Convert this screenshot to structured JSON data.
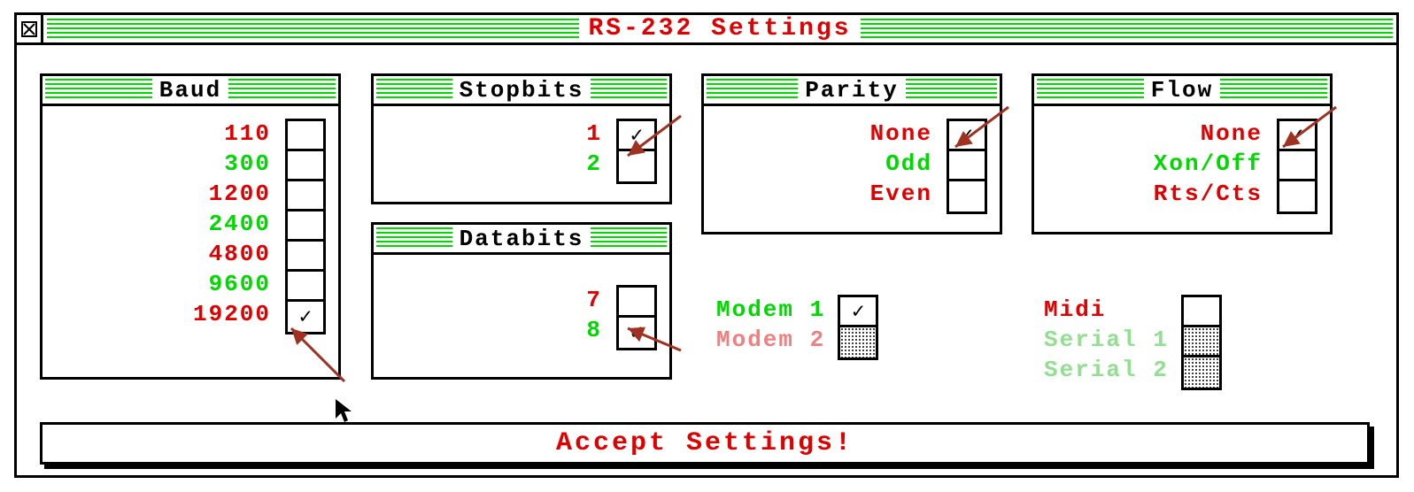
{
  "title": "RS-232 Settings",
  "panels": {
    "baud": {
      "title": "Baud",
      "options": [
        "110",
        "300",
        "1200",
        "2400",
        "4800",
        "9600",
        "19200"
      ],
      "selected_index": 6
    },
    "stopbits": {
      "title": "Stopbits",
      "options": [
        "1",
        "2"
      ],
      "selected_index": 0
    },
    "databits": {
      "title": "Databits",
      "options": [
        "7",
        "8"
      ],
      "selected_index": 1
    },
    "parity": {
      "title": "Parity",
      "options": [
        "None",
        "Odd",
        "Even"
      ],
      "selected_index": 0
    },
    "flow": {
      "title": "Flow",
      "options": [
        "None",
        "Xon/Off",
        "Rts/Cts"
      ],
      "selected_index": 0
    }
  },
  "modem": {
    "options": [
      "Modem 1",
      "Modem 2"
    ],
    "selected_index": 0,
    "disabled_index": 1
  },
  "port": {
    "options": [
      "Midi",
      "Serial 1",
      "Serial 2"
    ],
    "disabled": [
      1,
      2
    ]
  },
  "accept_label": "Accept Settings!"
}
